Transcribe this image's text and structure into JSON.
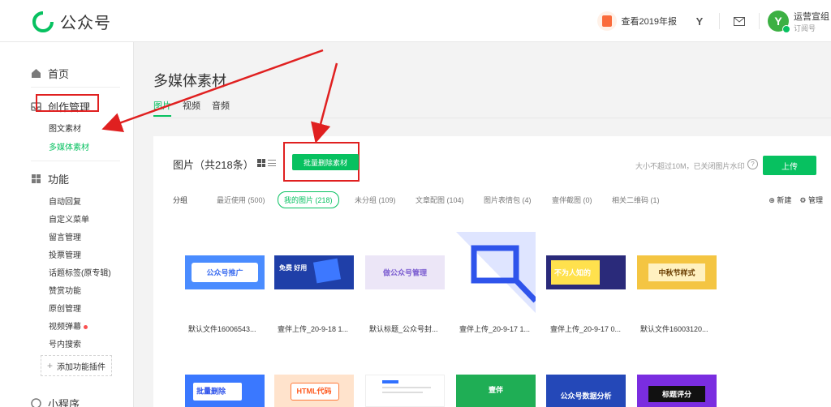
{
  "header": {
    "logo_text": "公众号",
    "annual_report": "查看2019年报",
    "user_name": "运营宣组",
    "user_type": "订阅号",
    "avatar_letter": "Y",
    "y_button": "Y",
    "mail_icon": "mail-icon"
  },
  "sidebar": {
    "home": "首页",
    "creation": "创作管理",
    "creation_items": [
      "图文素材",
      "多媒体素材"
    ],
    "functions": "功能",
    "function_items": [
      "自动回复",
      "自定义菜单",
      "留言管理",
      "投票管理",
      "话题标签(原专辑)",
      "赞赏功能",
      "原创管理",
      "视频弹幕",
      "号内搜索"
    ],
    "add_plugin": "添加功能插件",
    "mini_program": "小程序"
  },
  "page": {
    "title": "多媒体素材",
    "tabs": [
      "图片",
      "视频",
      "音频"
    ]
  },
  "content": {
    "title": "图片（共218条）",
    "batch_delete": "批量删除素材",
    "limit_text": "大小不超过10M，已关闭图片水印",
    "help": "?",
    "upload": "上传",
    "group_label": "分组",
    "groups": [
      "最近使用 (500)",
      "我的图片 (218)",
      "未分组 (109)",
      "文章配图 (104)",
      "图片表情包 (4)",
      "壹伴截图 (0)",
      "相关二维码 (1)"
    ],
    "new_group": "⊕ 新建",
    "manage": "⚙ 管理"
  },
  "images": [
    {
      "caption": "默认文件16006543...",
      "text": "公众号推广"
    },
    {
      "caption": "壹伴上传_20-9-18 1...",
      "text": "免费 好用"
    },
    {
      "caption": "默认标题_公众号封...",
      "text": "做公众号管理"
    },
    {
      "caption": "壹伴上传_20-9-17 1...",
      "text": ""
    },
    {
      "caption": "壹伴上传_20-9-17 0...",
      "text": "不为人知的"
    },
    {
      "caption": "默认文件16003120...",
      "text": "中秋节样式"
    }
  ],
  "images_row2": [
    {
      "text": "批量删除"
    },
    {
      "text": "HTML代码"
    },
    {
      "text": ""
    },
    {
      "text": "壹伴"
    },
    {
      "text": "公众号数据分析"
    },
    {
      "text": "标题评分"
    }
  ],
  "colors": {
    "accent": "#07c160",
    "highlight": "#e02020"
  }
}
